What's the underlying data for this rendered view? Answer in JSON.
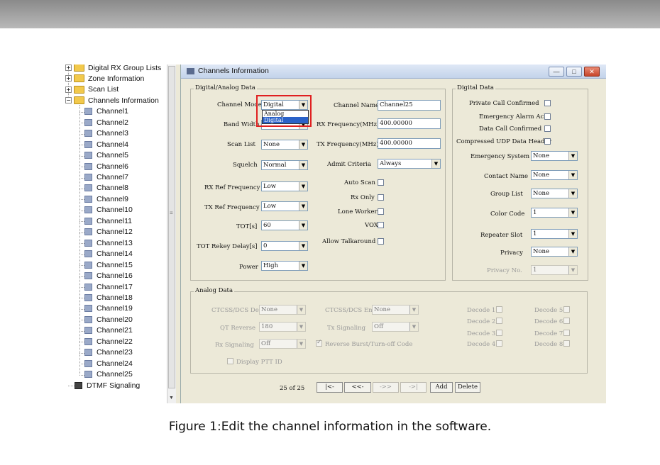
{
  "tree": {
    "folders": [
      "Digital RX Group Lists",
      "Zone Information",
      "Scan List",
      "Channels Information"
    ],
    "channels": [
      "Channel1",
      "Channel2",
      "Channel3",
      "Channel4",
      "Channel5",
      "Channel6",
      "Channel7",
      "Channel8",
      "Channel9",
      "Channel10",
      "Channel11",
      "Channel12",
      "Channel13",
      "Channel14",
      "Channel15",
      "Channel16",
      "Channel17",
      "Channel18",
      "Channel19",
      "Channel20",
      "Channel21",
      "Channel22",
      "Channel23",
      "Channel24",
      "Channel25"
    ],
    "last": "DTMF Signaling"
  },
  "window": {
    "title": "Channels Information",
    "min": "—",
    "max": "□",
    "close": "✕"
  },
  "digital_analog": {
    "label": "Digital/Analog Data",
    "channel_mode": {
      "label": "Channel Mode",
      "value": "Digital",
      "options": [
        "Analog",
        "Digital"
      ]
    },
    "band_width": {
      "label": "Band Width"
    },
    "scan_list": {
      "label": "Scan List",
      "value": "None"
    },
    "squelch": {
      "label": "Squelch",
      "value": "Normal"
    },
    "rx_ref": {
      "label": "RX Ref Frequency",
      "value": "Low"
    },
    "tx_ref": {
      "label": "TX Ref Frequency",
      "value": "Low"
    },
    "tot": {
      "label": "TOT[s]",
      "value": "60"
    },
    "tot_rekey": {
      "label": "TOT Rekey Delay[s]",
      "value": "0"
    },
    "power": {
      "label": "Power",
      "value": "High"
    },
    "channel_name": {
      "label": "Channel Name",
      "value": "Channel25"
    },
    "rx_freq": {
      "label": "RX Frequency(MHz)",
      "value": "400.00000"
    },
    "tx_freq": {
      "label": "TX Frequency(MHz)",
      "value": "400.00000"
    },
    "admit": {
      "label": "Admit Criteria",
      "value": "Always"
    },
    "auto_scan": "Auto Scan",
    "rx_only": "Rx Only",
    "lone_worker": "Lone Worker",
    "vox": "VOX",
    "allow_talkaround": "Allow Talkaround"
  },
  "digital": {
    "label": "Digital Data",
    "private_call": "Private Call Confirmed",
    "emergency_ack": "Emergency Alarm Ack",
    "data_call": "Data Call Confirmed",
    "udp_header": "Compressed UDP Data Header",
    "emergency_system": {
      "label": "Emergency System",
      "value": "None"
    },
    "contact_name": {
      "label": "Contact Name",
      "value": "None"
    },
    "group_list": {
      "label": "Group List",
      "value": "None"
    },
    "color_code": {
      "label": "Color Code",
      "value": "1"
    },
    "repeater_slot": {
      "label": "Repeater Slot",
      "value": "1"
    },
    "privacy": {
      "label": "Privacy",
      "value": "None"
    },
    "privacy_no": {
      "label": "Privacy No.",
      "value": "1"
    }
  },
  "analog": {
    "label": "Analog Data",
    "ctcss_dec": {
      "label": "CTCSS/DCS Dec",
      "value": "None"
    },
    "qt_reverse": {
      "label": "QT Reverse",
      "value": "180"
    },
    "rx_signaling": {
      "label": "Rx Signaling",
      "value": "Off"
    },
    "ctcss_enc": {
      "label": "CTCSS/DCS Enc",
      "value": "None"
    },
    "tx_signaling": {
      "label": "Tx Signaling",
      "value": "Off"
    },
    "reverse_burst": "Reverse Burst/Turn-off Code",
    "display_ptt": "Display PTT ID",
    "decodes": [
      "Decode 1",
      "Decode 2",
      "Decode 3",
      "Decode 4",
      "Decode 5",
      "Decode 6",
      "Decode 7",
      "Decode 8"
    ]
  },
  "nav": {
    "position": "25 of 25",
    "first": "|<-",
    "prev": "<<-",
    "next": "->>",
    "last": "->|",
    "add": "Add",
    "delete": "Delete"
  },
  "caption": "Figure 1:Edit the channel information in the software."
}
